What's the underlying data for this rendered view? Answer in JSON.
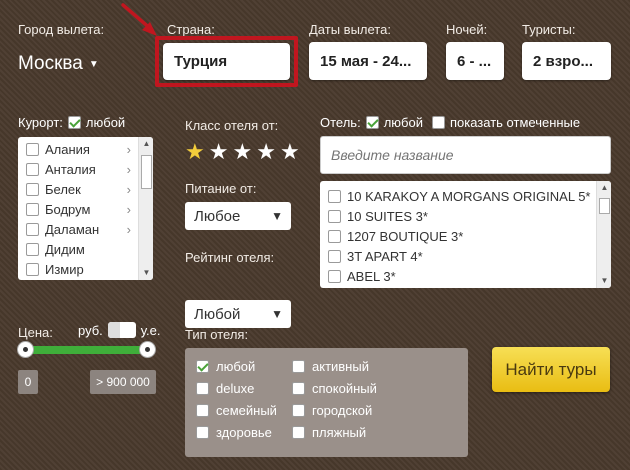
{
  "labels": {
    "city": "Город вылета:",
    "country": "Страна:",
    "dates": "Даты вылета:",
    "nights": "Ночей:",
    "tourists": "Туристы:",
    "resort": "Курорт:",
    "resort_any": "любой",
    "hotel_class": "Класс отеля от:",
    "meal": "Питание от:",
    "rating": "Рейтинг отеля:",
    "hotel": "Отель:",
    "hotel_any": "любой",
    "hotel_marked": "показать отмеченные",
    "price": "Цена:",
    "currency_rub": "руб.",
    "currency_ue": "у.е.",
    "hotel_type": "Тип отеля:"
  },
  "fields": {
    "city": "Москва",
    "country": "Турция",
    "dates": "15 мая - 24...",
    "nights": "6 - ...",
    "tourists": "2 взро...",
    "hotel_search_placeholder": "Введите название",
    "meal": "Любое",
    "rating": "Любой"
  },
  "resorts": [
    "Алания",
    "Анталия",
    "Белек",
    "Бодрум",
    "Даламан",
    "Дидим",
    "Измир"
  ],
  "hotels": [
    "10 KARAKOY A MORGANS ORIGINAL 5*",
    "10 SUITES 3*",
    "1207 BOUTIQUE 3*",
    "3T APART 4*",
    "ABEL 3*"
  ],
  "stars": {
    "selected": 1,
    "total": 5
  },
  "price": {
    "min": "0",
    "max": "> 900 000"
  },
  "hotel_types": {
    "col1": [
      "любой",
      "deluxe",
      "семейный",
      "здоровье"
    ],
    "col2": [
      "активный",
      "спокойный",
      "городской",
      "пляжный"
    ]
  },
  "search_button": "Найти туры",
  "colors": {
    "accent_red": "#c0161f",
    "button_yellow": "#f0cc2a",
    "slider_green": "#3fae3a",
    "star_gold": "#f3cd3b"
  }
}
